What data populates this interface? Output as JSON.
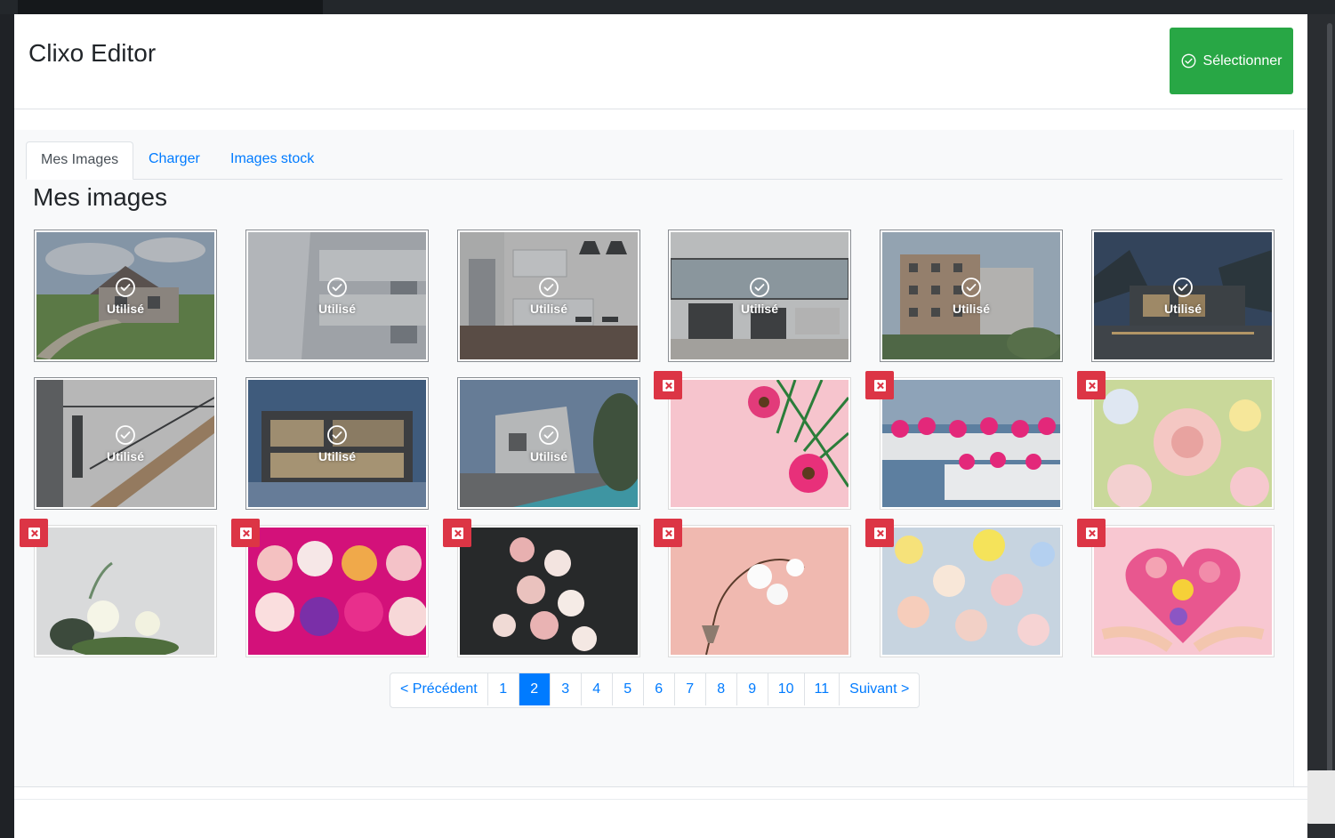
{
  "modal": {
    "title": "Clixo Editor",
    "select_label": "Sélectionner"
  },
  "tabs": [
    {
      "label": "Mes Images",
      "active": true
    },
    {
      "label": "Charger",
      "active": false
    },
    {
      "label": "Images stock",
      "active": false
    }
  ],
  "section_title": "Mes images",
  "used_label": "Utilisé",
  "images": [
    {
      "name": "house-exterior",
      "used": true
    },
    {
      "name": "white-balconies",
      "used": true
    },
    {
      "name": "modern-kitchen",
      "used": true
    },
    {
      "name": "living-room",
      "used": true
    },
    {
      "name": "apartment-building",
      "used": true
    },
    {
      "name": "night-villa",
      "used": true
    },
    {
      "name": "staircase",
      "used": true
    },
    {
      "name": "glass-house-night",
      "used": true
    },
    {
      "name": "pool-villa",
      "used": true
    },
    {
      "name": "pink-gerbera-palm",
      "used": false
    },
    {
      "name": "flower-planters",
      "used": false
    },
    {
      "name": "rose-bouquet",
      "used": false
    },
    {
      "name": "white-roses-grey",
      "used": false
    },
    {
      "name": "colorful-roses-box",
      "used": false
    },
    {
      "name": "dark-roses",
      "used": false
    },
    {
      "name": "white-orchid-pink",
      "used": false
    },
    {
      "name": "mixed-bouquet",
      "used": false
    },
    {
      "name": "heart-flowers-hands",
      "used": false
    }
  ],
  "pagination": {
    "prev": "< Précédent",
    "next": "Suivant >",
    "pages": [
      "1",
      "2",
      "3",
      "4",
      "5",
      "6",
      "7",
      "8",
      "9",
      "10",
      "11"
    ],
    "current": "2"
  },
  "colors": {
    "success": "#28a745",
    "primary": "#007bff",
    "danger": "#dc3545"
  }
}
